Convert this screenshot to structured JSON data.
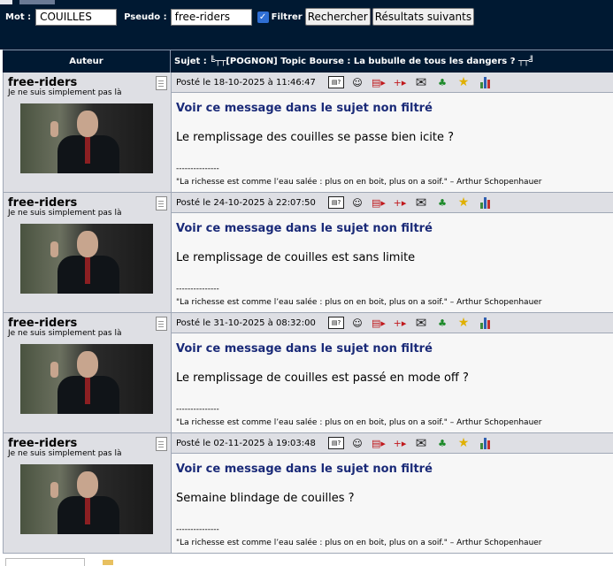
{
  "search": {
    "mot_label": "Mot :",
    "mot_value": "COUILLES",
    "pseudo_label": "Pseudo :",
    "pseudo_value": "free-riders",
    "filter_label": "Filtrer",
    "search_button": "Rechercher",
    "next_button": "Résultats suivants"
  },
  "header": {
    "author_col": "Auteur",
    "subject": "Sujet : ╚┬┬[POGNON] Topic Bourse : La bubulle de tous les dangers ? ┬┬╝"
  },
  "posts": [
    {
      "author": "free-riders",
      "tagline": "Je ne suis simplement pas là",
      "date": "Posté le 18-10-2025 à 11:46:47",
      "link": "Voir ce message dans le sujet non filtré",
      "message": "Le remplissage des couilles se passe bien icite ?",
      "separator": "---------------",
      "signature": "\"La richesse est comme l’eau salée : plus on en boit, plus on a soif.\" – Arthur Schopenhauer"
    },
    {
      "author": "free-riders",
      "tagline": "Je ne suis simplement pas là",
      "date": "Posté le 24-10-2025 à 22:07:50",
      "link": "Voir ce message dans le sujet non filtré",
      "message": "Le remplissage de couilles est sans limite",
      "separator": "---------------",
      "signature": "\"La richesse est comme l’eau salée : plus on en boit, plus on a soif.\" – Arthur Schopenhauer"
    },
    {
      "author": "free-riders",
      "tagline": "Je ne suis simplement pas là",
      "date": "Posté le 31-10-2025 à 08:32:00",
      "link": "Voir ce message dans le sujet non filtré",
      "message": "Le remplissage de couilles est passé en mode off ?",
      "separator": "---------------",
      "signature": "\"La richesse est comme l’eau salée : plus on en boit, plus on a soif.\" – Arthur Schopenhauer"
    },
    {
      "author": "free-riders",
      "tagline": "Je ne suis simplement pas là",
      "date": "Posté le 02-11-2025 à 19:03:48",
      "link": "Voir ce message dans le sujet non filtré",
      "message": "Semaine blindage de couilles ?",
      "separator": "---------------",
      "signature": "\"La richesse est comme l’eau salée : plus on en boit, plus on a soif.\" – Arthur Schopenhauer"
    }
  ],
  "icons": [
    "profile-icon",
    "smiley-icon",
    "quote-icon",
    "multi-quote-icon",
    "mail-icon",
    "alert-icon",
    "favorite-star-icon",
    "stats-icon"
  ],
  "colors": {
    "header_bg": "#001932",
    "link": "#1a2a78",
    "row_bg": "#dedfe4"
  }
}
